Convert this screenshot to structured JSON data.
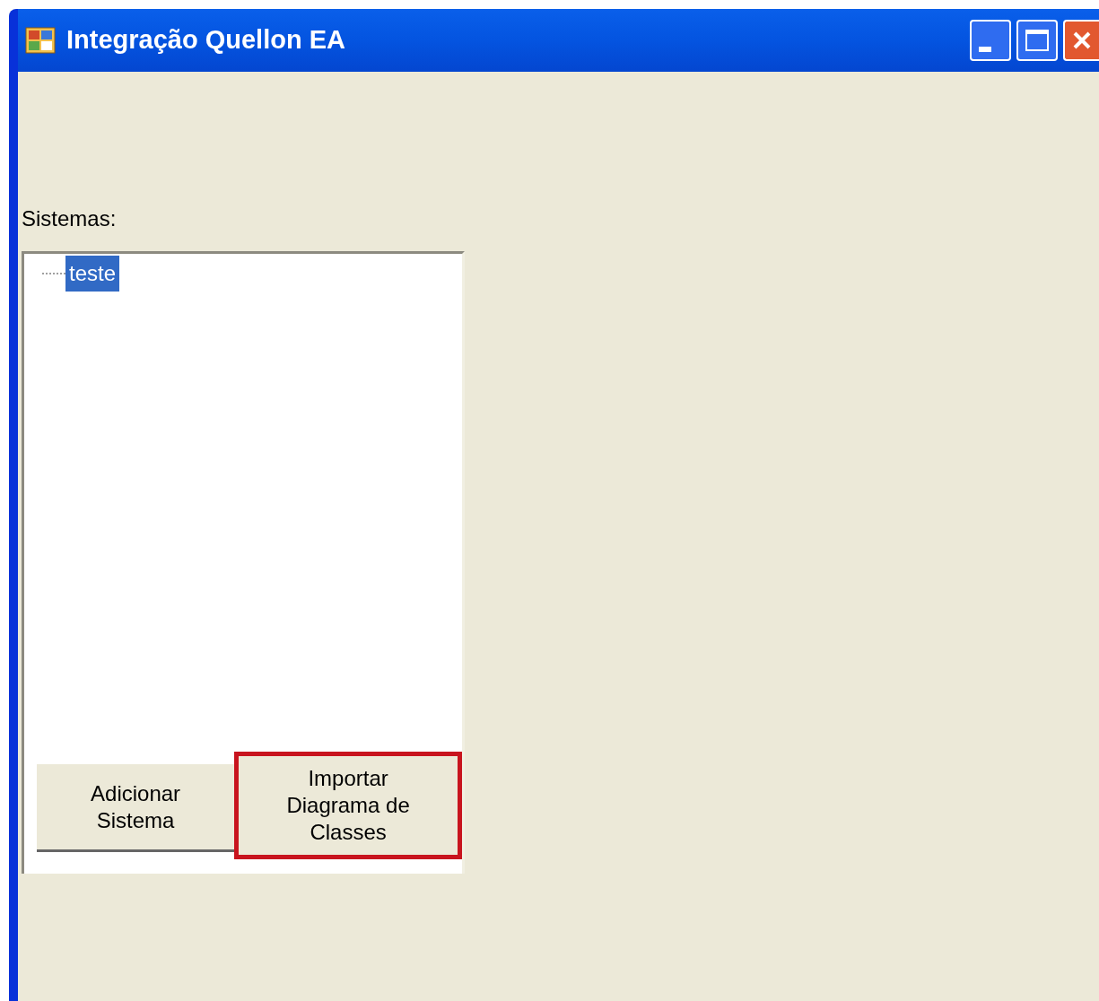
{
  "window": {
    "title": "Integração Quellon EA"
  },
  "systems_label": "Sistemas:",
  "tree": {
    "items": [
      {
        "label": "teste",
        "selected": true
      }
    ]
  },
  "buttons": [
    {
      "label": "Adicionar Sistema",
      "highlighted": false
    },
    {
      "label": "Importar Diagrama de Classes",
      "highlighted": true
    }
  ]
}
